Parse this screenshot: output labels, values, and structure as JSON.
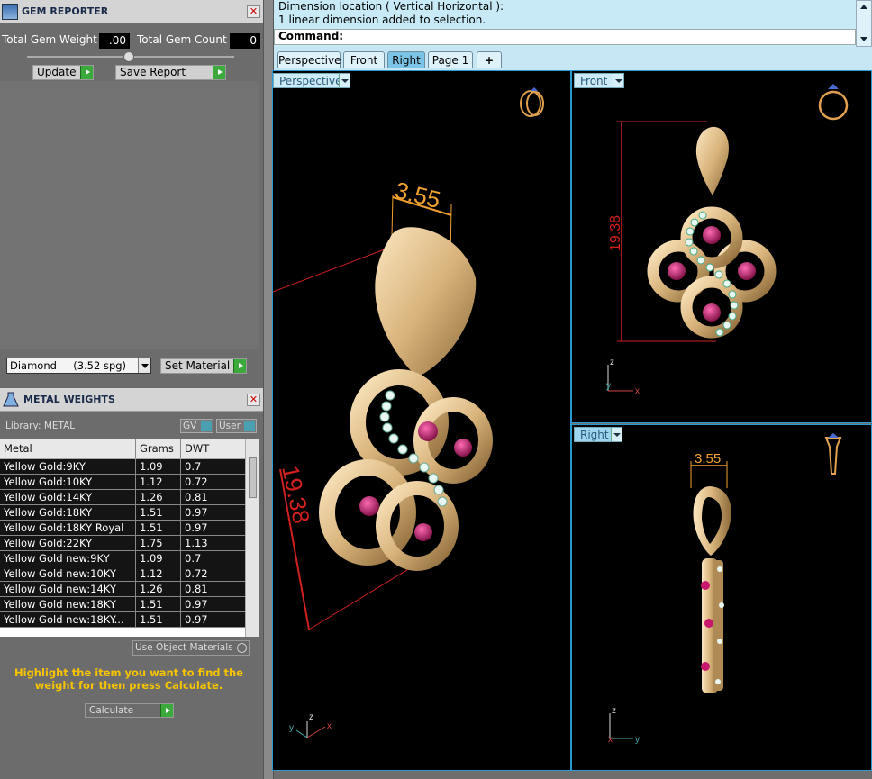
{
  "gem_reporter": {
    "title": "GEM REPORTER",
    "total_gem_weight_label": "Total Gem Weight",
    "total_gem_weight_value": ".00",
    "total_gem_count_label": "Total Gem Count",
    "total_gem_count_value": "0",
    "update_label": "Update",
    "save_report_label": "Save Report",
    "material_select": "Diamond     (3.52 spg)",
    "set_material_label": "Set Material"
  },
  "metal_weights": {
    "title": "METAL WEIGHTS",
    "library_label": "Library: METAL",
    "gv_label": "GV",
    "user_label": "User",
    "columns": [
      "Metal",
      "Grams",
      "DWT"
    ],
    "rows": [
      [
        "Yellow Gold:9KY",
        "1.09",
        "0.7"
      ],
      [
        "Yellow Gold:10KY",
        "1.12",
        "0.72"
      ],
      [
        "Yellow Gold:14KY",
        "1.26",
        "0.81"
      ],
      [
        "Yellow Gold:18KY",
        "1.51",
        "0.97"
      ],
      [
        "Yellow Gold:18KY Royal",
        "1.51",
        "0.97"
      ],
      [
        "Yellow Gold:22KY",
        "1.75",
        "1.13"
      ],
      [
        "Yellow Gold new:9KY",
        "1.09",
        "0.7"
      ],
      [
        "Yellow Gold new:10KY",
        "1.12",
        "0.72"
      ],
      [
        "Yellow Gold new:14KY",
        "1.26",
        "0.81"
      ],
      [
        "Yellow Gold new:18KY",
        "1.51",
        "0.97"
      ],
      [
        "Yellow Gold new:18KY...",
        "1.51",
        "0.97"
      ]
    ],
    "use_object_materials_label": "Use Object Materials",
    "hint": "Highlight the item you want to find the weight for then press Calculate.",
    "calculate_label": "Calculate"
  },
  "command": {
    "line1": "Dimension location ( Vertical  Horizontal ):",
    "line2": "1 linear dimension added to selection.",
    "prompt": "Command:"
  },
  "tabs": [
    "Perspective",
    "Front",
    "Right",
    "Page 1"
  ],
  "viewports": {
    "perspective": {
      "label": "Perspective",
      "dim_top": "3.55",
      "dim_side": "19.38"
    },
    "front": {
      "label": "Front",
      "dim": "19.38"
    },
    "right": {
      "label": "Right",
      "dim": "3.55"
    }
  },
  "axes": {
    "x": "x",
    "y": "y",
    "z": "z"
  },
  "colors": {
    "viewport_border": "#2a9ad0",
    "dimension_orange": "#f0a030",
    "dimension_red": "#d02020",
    "gem_ruby": "#c8186e",
    "gold": "#e0c080"
  }
}
